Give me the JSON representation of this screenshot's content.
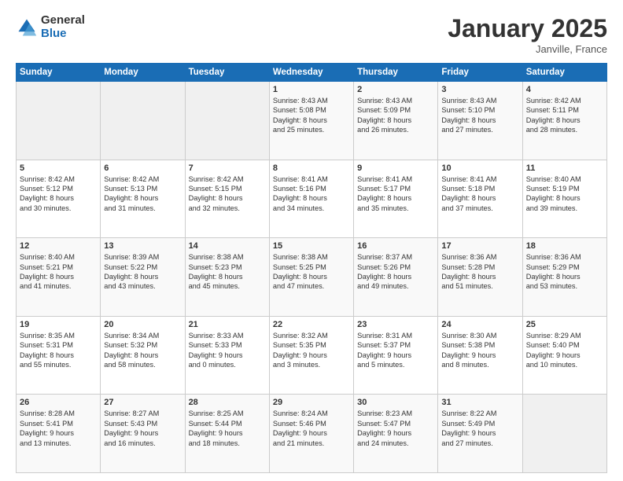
{
  "logo": {
    "general": "General",
    "blue": "Blue"
  },
  "header": {
    "month": "January 2025",
    "location": "Janville, France"
  },
  "weekdays": [
    "Sunday",
    "Monday",
    "Tuesday",
    "Wednesday",
    "Thursday",
    "Friday",
    "Saturday"
  ],
  "weeks": [
    [
      {
        "day": "",
        "content": ""
      },
      {
        "day": "",
        "content": ""
      },
      {
        "day": "",
        "content": ""
      },
      {
        "day": "1",
        "content": "Sunrise: 8:43 AM\nSunset: 5:08 PM\nDaylight: 8 hours\nand 25 minutes."
      },
      {
        "day": "2",
        "content": "Sunrise: 8:43 AM\nSunset: 5:09 PM\nDaylight: 8 hours\nand 26 minutes."
      },
      {
        "day": "3",
        "content": "Sunrise: 8:43 AM\nSunset: 5:10 PM\nDaylight: 8 hours\nand 27 minutes."
      },
      {
        "day": "4",
        "content": "Sunrise: 8:42 AM\nSunset: 5:11 PM\nDaylight: 8 hours\nand 28 minutes."
      }
    ],
    [
      {
        "day": "5",
        "content": "Sunrise: 8:42 AM\nSunset: 5:12 PM\nDaylight: 8 hours\nand 30 minutes."
      },
      {
        "day": "6",
        "content": "Sunrise: 8:42 AM\nSunset: 5:13 PM\nDaylight: 8 hours\nand 31 minutes."
      },
      {
        "day": "7",
        "content": "Sunrise: 8:42 AM\nSunset: 5:15 PM\nDaylight: 8 hours\nand 32 minutes."
      },
      {
        "day": "8",
        "content": "Sunrise: 8:41 AM\nSunset: 5:16 PM\nDaylight: 8 hours\nand 34 minutes."
      },
      {
        "day": "9",
        "content": "Sunrise: 8:41 AM\nSunset: 5:17 PM\nDaylight: 8 hours\nand 35 minutes."
      },
      {
        "day": "10",
        "content": "Sunrise: 8:41 AM\nSunset: 5:18 PM\nDaylight: 8 hours\nand 37 minutes."
      },
      {
        "day": "11",
        "content": "Sunrise: 8:40 AM\nSunset: 5:19 PM\nDaylight: 8 hours\nand 39 minutes."
      }
    ],
    [
      {
        "day": "12",
        "content": "Sunrise: 8:40 AM\nSunset: 5:21 PM\nDaylight: 8 hours\nand 41 minutes."
      },
      {
        "day": "13",
        "content": "Sunrise: 8:39 AM\nSunset: 5:22 PM\nDaylight: 8 hours\nand 43 minutes."
      },
      {
        "day": "14",
        "content": "Sunrise: 8:38 AM\nSunset: 5:23 PM\nDaylight: 8 hours\nand 45 minutes."
      },
      {
        "day": "15",
        "content": "Sunrise: 8:38 AM\nSunset: 5:25 PM\nDaylight: 8 hours\nand 47 minutes."
      },
      {
        "day": "16",
        "content": "Sunrise: 8:37 AM\nSunset: 5:26 PM\nDaylight: 8 hours\nand 49 minutes."
      },
      {
        "day": "17",
        "content": "Sunrise: 8:36 AM\nSunset: 5:28 PM\nDaylight: 8 hours\nand 51 minutes."
      },
      {
        "day": "18",
        "content": "Sunrise: 8:36 AM\nSunset: 5:29 PM\nDaylight: 8 hours\nand 53 minutes."
      }
    ],
    [
      {
        "day": "19",
        "content": "Sunrise: 8:35 AM\nSunset: 5:31 PM\nDaylight: 8 hours\nand 55 minutes."
      },
      {
        "day": "20",
        "content": "Sunrise: 8:34 AM\nSunset: 5:32 PM\nDaylight: 8 hours\nand 58 minutes."
      },
      {
        "day": "21",
        "content": "Sunrise: 8:33 AM\nSunset: 5:33 PM\nDaylight: 9 hours\nand 0 minutes."
      },
      {
        "day": "22",
        "content": "Sunrise: 8:32 AM\nSunset: 5:35 PM\nDaylight: 9 hours\nand 3 minutes."
      },
      {
        "day": "23",
        "content": "Sunrise: 8:31 AM\nSunset: 5:37 PM\nDaylight: 9 hours\nand 5 minutes."
      },
      {
        "day": "24",
        "content": "Sunrise: 8:30 AM\nSunset: 5:38 PM\nDaylight: 9 hours\nand 8 minutes."
      },
      {
        "day": "25",
        "content": "Sunrise: 8:29 AM\nSunset: 5:40 PM\nDaylight: 9 hours\nand 10 minutes."
      }
    ],
    [
      {
        "day": "26",
        "content": "Sunrise: 8:28 AM\nSunset: 5:41 PM\nDaylight: 9 hours\nand 13 minutes."
      },
      {
        "day": "27",
        "content": "Sunrise: 8:27 AM\nSunset: 5:43 PM\nDaylight: 9 hours\nand 16 minutes."
      },
      {
        "day": "28",
        "content": "Sunrise: 8:25 AM\nSunset: 5:44 PM\nDaylight: 9 hours\nand 18 minutes."
      },
      {
        "day": "29",
        "content": "Sunrise: 8:24 AM\nSunset: 5:46 PM\nDaylight: 9 hours\nand 21 minutes."
      },
      {
        "day": "30",
        "content": "Sunrise: 8:23 AM\nSunset: 5:47 PM\nDaylight: 9 hours\nand 24 minutes."
      },
      {
        "day": "31",
        "content": "Sunrise: 8:22 AM\nSunset: 5:49 PM\nDaylight: 9 hours\nand 27 minutes."
      },
      {
        "day": "",
        "content": ""
      }
    ]
  ]
}
